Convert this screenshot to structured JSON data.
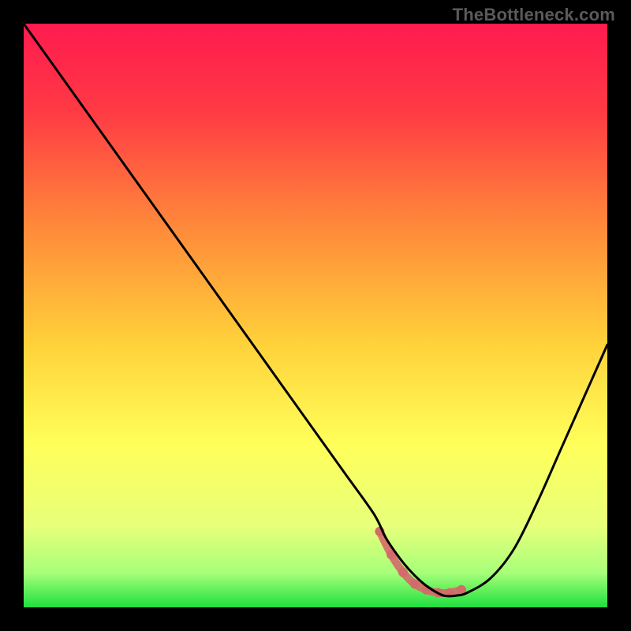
{
  "watermark": "TheBottleneck.com",
  "chart_data": {
    "type": "line",
    "title": "",
    "xlabel": "",
    "ylabel": "",
    "xlim": [
      0,
      100
    ],
    "ylim": [
      0,
      100
    ],
    "series": [
      {
        "name": "bottleneck-curve",
        "x": [
          0,
          5,
          10,
          15,
          20,
          25,
          30,
          35,
          40,
          45,
          50,
          55,
          60,
          62,
          64,
          66,
          68,
          70,
          72,
          74,
          76,
          80,
          84,
          88,
          92,
          96,
          100
        ],
        "values": [
          100,
          93,
          86,
          79,
          72,
          65,
          58,
          51,
          44,
          37,
          30,
          23,
          16,
          12,
          9,
          6.5,
          4.5,
          3,
          2,
          2,
          2.5,
          5,
          10,
          18,
          27,
          36,
          45
        ]
      }
    ],
    "markers": {
      "name": "highlight-band",
      "color": "#d46a6a",
      "x": [
        61,
        63,
        65,
        67,
        69,
        71,
        73,
        75
      ],
      "values": [
        13,
        9,
        6,
        4,
        3,
        2.5,
        2.5,
        3
      ]
    },
    "gradient_stops": [
      {
        "offset": 0.0,
        "color": "#ff1a4f"
      },
      {
        "offset": 0.15,
        "color": "#ff3a44"
      },
      {
        "offset": 0.35,
        "color": "#ff8a3a"
      },
      {
        "offset": 0.55,
        "color": "#ffd23a"
      },
      {
        "offset": 0.72,
        "color": "#ffff5a"
      },
      {
        "offset": 0.86,
        "color": "#e8ff7a"
      },
      {
        "offset": 0.94,
        "color": "#a8ff7a"
      },
      {
        "offset": 1.0,
        "color": "#20e040"
      }
    ]
  }
}
